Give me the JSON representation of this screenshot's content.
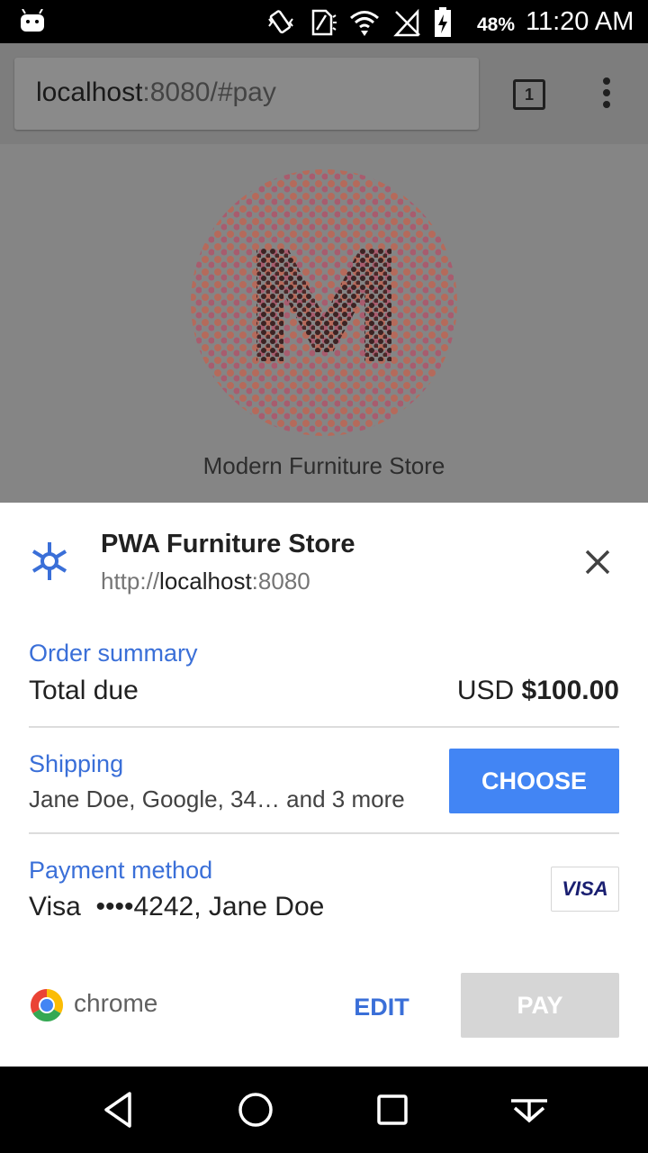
{
  "status_bar": {
    "battery_percent": "48%",
    "time": "11:20 AM"
  },
  "browser": {
    "url_host": "localhost",
    "url_rest": ":8080/#pay",
    "tab_count": "1"
  },
  "page": {
    "store_name": "Modern Furniture Store"
  },
  "payment_sheet": {
    "merchant_name": "PWA Furniture Store",
    "merchant_url_scheme": "http://",
    "merchant_url_host": "localhost",
    "merchant_url_port": ":8080",
    "order_summary_label": "Order summary",
    "total_label": "Total due",
    "total_currency": "USD",
    "total_amount": "$100.00",
    "shipping_label": "Shipping",
    "shipping_value": "Jane Doe, Google, 34… and 3 more",
    "choose_label": "CHOOSE",
    "payment_method_label": "Payment method",
    "payment_method_value": "Visa  ••••4242, Jane Doe",
    "card_brand": "VISA",
    "chrome_label": "chrome",
    "edit_label": "EDIT",
    "pay_label": "PAY"
  },
  "colors": {
    "accent_blue": "#4285f4",
    "link_blue": "#3a6fd8",
    "disabled_gray": "#d6d6d6"
  },
  "icons": [
    "android-icon",
    "vibrate-icon",
    "no-sim-icon",
    "wifi-icon",
    "no-signal-icon",
    "battery-charging-icon",
    "tabs-icon",
    "overflow-menu-icon",
    "merchant-icon",
    "close-icon",
    "chrome-logo-icon",
    "back-icon",
    "home-icon",
    "recents-icon",
    "keyboard-hide-icon"
  ]
}
